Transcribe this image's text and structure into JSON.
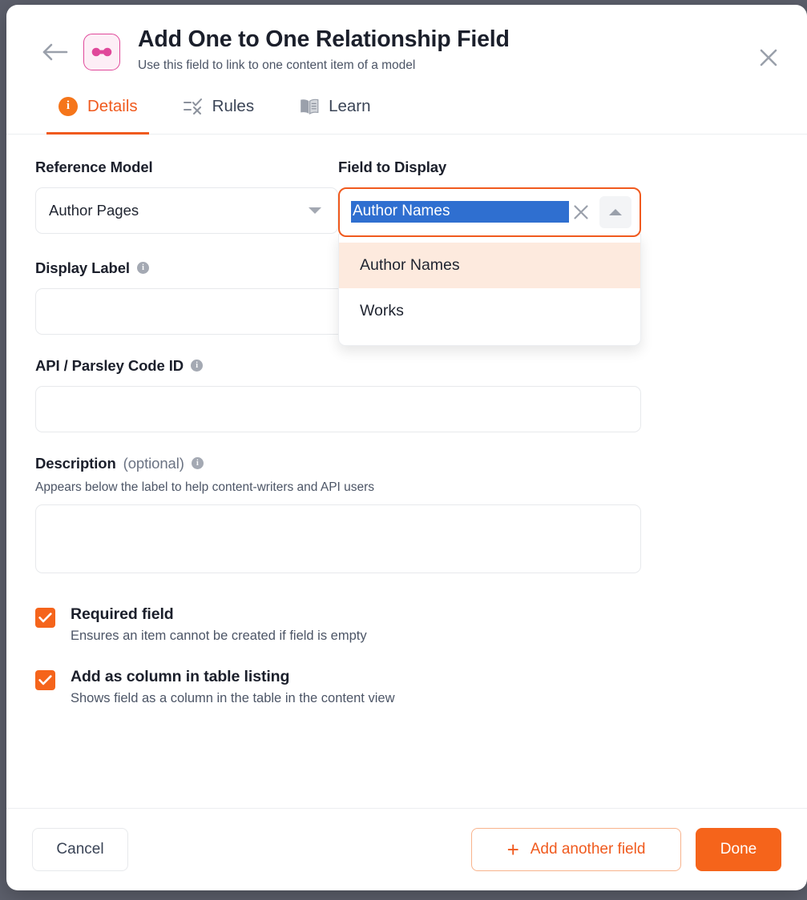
{
  "modal": {
    "back_icon": "back-arrow-icon",
    "type_icon": "one-to-one-relationship-icon",
    "title": "Add One to One Relationship Field",
    "subtitle": "Use this field to link to one content item of a model",
    "close_icon": "close-icon"
  },
  "tabs": [
    {
      "label": "Details",
      "icon": "info-circle-icon",
      "active": true
    },
    {
      "label": "Rules",
      "icon": "checklist-icon",
      "active": false
    },
    {
      "label": "Learn",
      "icon": "book-icon",
      "active": false
    }
  ],
  "form": {
    "reference_model": {
      "label": "Reference Model",
      "value": "Author Pages",
      "icon": "chevron-down-icon"
    },
    "field_to_display": {
      "label": "Field to Display",
      "value": "Author Names",
      "selected_text": true,
      "clear_icon": "clear-x-icon",
      "toggle_icon": "chevron-up-icon",
      "options": [
        {
          "label": "Author Names",
          "highlighted": true
        },
        {
          "label": "Works",
          "highlighted": false
        }
      ]
    },
    "display_label": {
      "label": "Display Label",
      "value": "",
      "info_icon": "info-icon"
    },
    "api_code_id": {
      "label": "API / Parsley Code ID",
      "value": "",
      "info_icon": "info-icon"
    },
    "description": {
      "label": "Description",
      "optional_suffix": "(optional)",
      "helper": "Appears below the label to help content-writers and API users",
      "value": "",
      "info_icon": "info-icon"
    }
  },
  "checkboxes": [
    {
      "title": "Required field",
      "helper": "Ensures an item cannot be created if field is empty",
      "checked": true
    },
    {
      "title": "Add as column in table listing",
      "helper": "Shows field as a column in the table in the content view",
      "checked": true
    }
  ],
  "footer": {
    "cancel_label": "Cancel",
    "add_another_label": "Add another field",
    "add_another_icon": "plus-icon",
    "done_label": "Done"
  },
  "colors": {
    "accent_orange": "#f5641b",
    "tab_active": "#f05a1e",
    "highlight_row": "#fdeade",
    "selection_blue": "#2f6fd0",
    "icon_pink": "#e0489a",
    "backdrop": "#5c5f6b"
  }
}
